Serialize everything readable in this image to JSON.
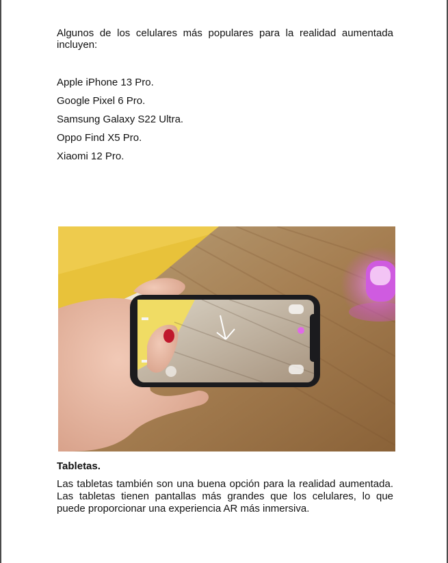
{
  "document": {
    "intro": "Algunos de los celulares más populares para la realidad aumentada incluyen:",
    "phones": [
      "Apple iPhone 13 Pro.",
      "Google Pixel 6 Pro.",
      "Samsung Galaxy S22 Ultra.",
      "Oppo Find X5 Pro.",
      "Xiaomi 12 Pro."
    ],
    "section_heading": "Tabletas.",
    "section_body": "Las tabletas también son una buena opción para la realidad aumentada. Las tabletas tienen pantallas más grandes que los celulares, lo que puede proporcionar una experiencia AR más inmersiva."
  },
  "photo": {
    "accent_colors": {
      "floor": "#b08a5c",
      "wall": "#e8c23a",
      "phone_body": "#1b1b1e",
      "nail": "#c0182c",
      "lamp": "#d24fd6"
    }
  }
}
